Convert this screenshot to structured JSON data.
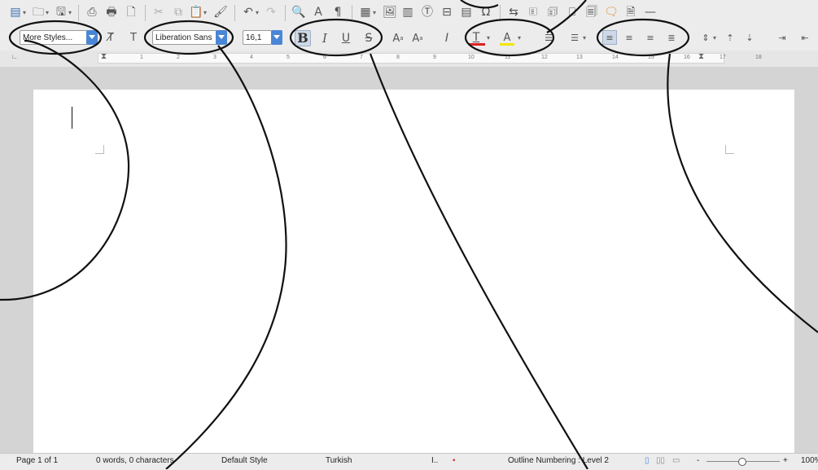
{
  "toolbar2": {
    "paragraph_style": "More Styles...",
    "font_name": "Liberation Sans",
    "font_size": "16,1",
    "bold_glyph": "B",
    "italic_glyph": "I",
    "underline_glyph": "U",
    "strike_glyph": "S",
    "superscript_glyph": "A",
    "subscript_glyph": "A",
    "clear_format_glyph": "I",
    "font_color_glyph": "T",
    "highlight_glyph": "A"
  },
  "ruler": {
    "numbers": [
      "1",
      "2",
      "3",
      "4",
      "5",
      "6",
      "7",
      "8",
      "9",
      "10",
      "11",
      "12",
      "13",
      "14",
      "15",
      "16",
      "17",
      "18"
    ]
  },
  "statusbar": {
    "page": "Page 1 of 1",
    "words": "0 words, 0 characters",
    "page_style": "Default Style",
    "language": "Turkish",
    "outline": "Outline Numbering : Level 2",
    "zoom_minus": "-",
    "zoom_plus": "+",
    "zoom": "100%"
  },
  "colors": {
    "accent": "#4a86d6",
    "font_color_bar": "#e02020",
    "highlight_bar": "#f2e600"
  }
}
